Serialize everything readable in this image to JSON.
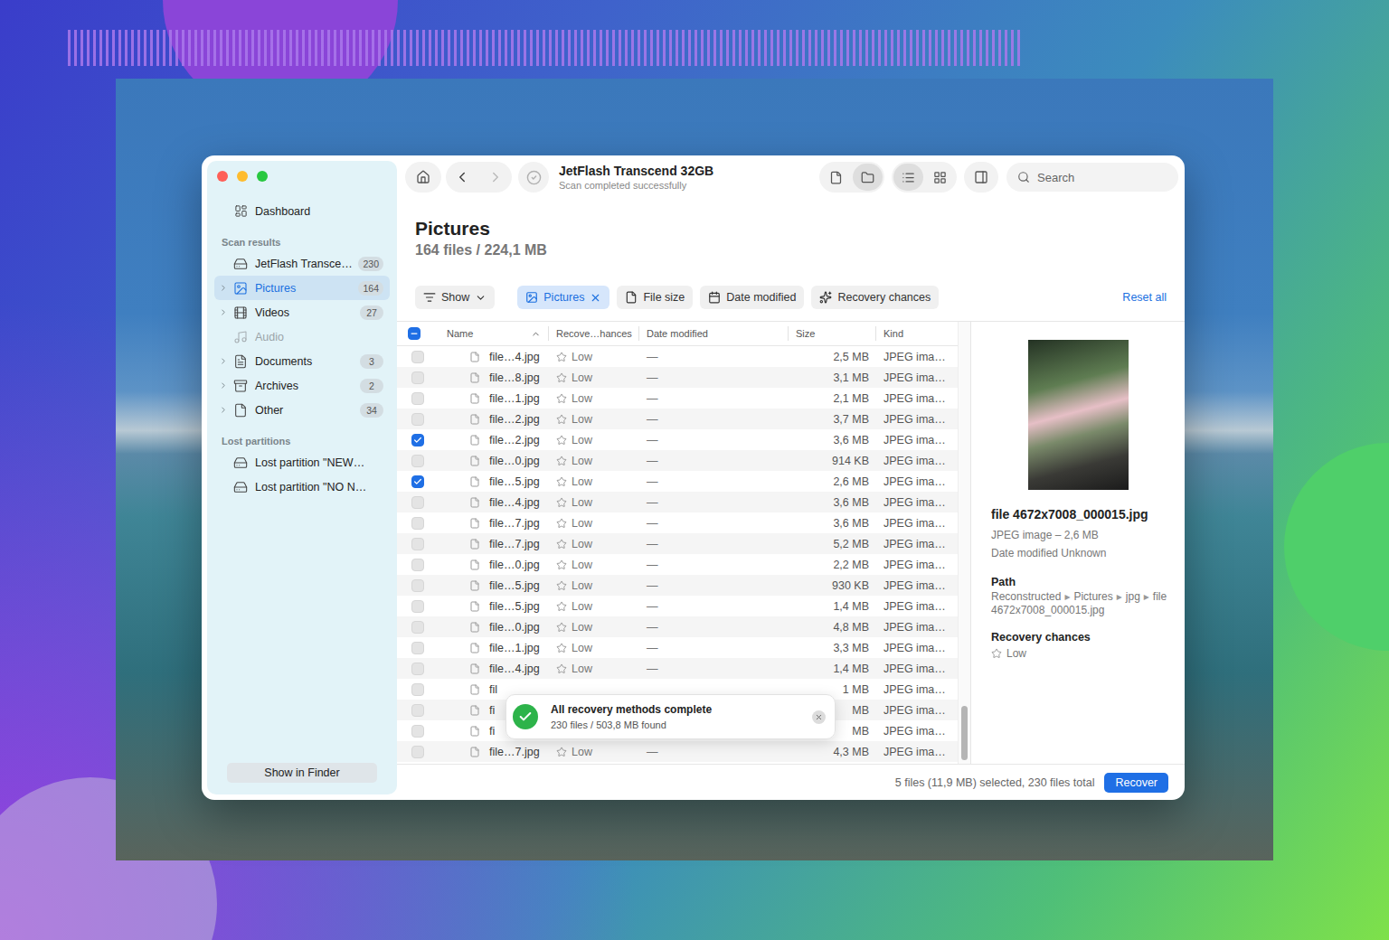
{
  "window": {
    "title": "JetFlash Transcend 32GB",
    "subtitle": "Scan completed successfully"
  },
  "toolbar": {
    "view_modes": [
      {
        "kind": "file",
        "selected": false
      },
      {
        "kind": "folder",
        "selected": true
      }
    ],
    "layouts": [
      {
        "kind": "list",
        "selected": true
      },
      {
        "kind": "grid",
        "selected": false
      }
    ],
    "search": {
      "placeholder": "Search"
    }
  },
  "sidebar": {
    "dashboard": "Dashboard",
    "sections": [
      {
        "header": "Scan results",
        "items": [
          {
            "label": "JetFlash Transce…",
            "count": "230",
            "kind": "drive",
            "expandable": false,
            "selected": false,
            "disabled": false
          },
          {
            "label": "Pictures",
            "count": "164",
            "kind": "pictures",
            "expandable": true,
            "selected": true,
            "disabled": false
          },
          {
            "label": "Videos",
            "count": "27",
            "kind": "videos",
            "expandable": true,
            "selected": false,
            "disabled": false
          },
          {
            "label": "Audio",
            "count": "",
            "kind": "audio",
            "expandable": false,
            "selected": false,
            "disabled": true
          },
          {
            "label": "Documents",
            "count": "3",
            "kind": "documents",
            "expandable": true,
            "selected": false,
            "disabled": false
          },
          {
            "label": "Archives",
            "count": "2",
            "kind": "archives",
            "expandable": true,
            "selected": false,
            "disabled": false
          },
          {
            "label": "Other",
            "count": "34",
            "kind": "other",
            "expandable": true,
            "selected": false,
            "disabled": false
          }
        ]
      },
      {
        "header": "Lost partitions",
        "items": [
          {
            "label": "Lost partition \"NEW…",
            "count": "",
            "kind": "partition",
            "expandable": false,
            "selected": false,
            "disabled": false
          },
          {
            "label": "Lost partition \"NO N…",
            "count": "",
            "kind": "partition",
            "expandable": false,
            "selected": false,
            "disabled": false
          }
        ]
      }
    ],
    "button": "Show in Finder"
  },
  "content": {
    "title": "Pictures",
    "summary": "164 files / 224,1 MB"
  },
  "filters": [
    {
      "label": "Show",
      "kind": "dropdown",
      "selected": false
    },
    {
      "label": "Pictures",
      "kind": "chip",
      "selected": true
    },
    {
      "label": "File size",
      "kind": "size",
      "selected": false
    },
    {
      "label": "Date modified",
      "kind": "date",
      "selected": false
    },
    {
      "label": "Recovery chances",
      "kind": "chances",
      "selected": false
    }
  ],
  "reset": "Reset all",
  "table": {
    "select_all": {
      "checked": false,
      "indeterminate": true
    },
    "columns": [
      {
        "label": "Name",
        "sorted": true
      },
      {
        "label": "Recove…hances",
        "sorted": false
      },
      {
        "label": "Date modified",
        "sorted": false
      },
      {
        "label": "Size",
        "sorted": false
      },
      {
        "label": "Kind",
        "sorted": false
      }
    ],
    "rows": [
      {
        "name": "file…4.jpg",
        "chances": "Low",
        "stars": 0,
        "date": "—",
        "size": "2,5 MB",
        "kind": "JPEG ima…",
        "checked": false
      },
      {
        "name": "file…8.jpg",
        "chances": "Low",
        "stars": 0,
        "date": "—",
        "size": "3,1 MB",
        "kind": "JPEG ima…",
        "checked": false
      },
      {
        "name": "file…1.jpg",
        "chances": "Low",
        "stars": 0,
        "date": "—",
        "size": "2,1 MB",
        "kind": "JPEG ima…",
        "checked": false
      },
      {
        "name": "file…2.jpg",
        "chances": "Low",
        "stars": 0,
        "date": "—",
        "size": "3,7 MB",
        "kind": "JPEG ima…",
        "checked": false
      },
      {
        "name": "file…2.jpg",
        "chances": "Low",
        "stars": 0,
        "date": "—",
        "size": "3,6 MB",
        "kind": "JPEG ima…",
        "checked": true
      },
      {
        "name": "file…0.jpg",
        "chances": "Low",
        "stars": 0,
        "date": "—",
        "size": "914 KB",
        "kind": "JPEG ima…",
        "checked": false
      },
      {
        "name": "file…5.jpg",
        "chances": "Low",
        "stars": 0,
        "date": "—",
        "size": "2,6 MB",
        "kind": "JPEG ima…",
        "checked": true
      },
      {
        "name": "file…4.jpg",
        "chances": "Low",
        "stars": 0,
        "date": "—",
        "size": "3,6 MB",
        "kind": "JPEG ima…",
        "checked": false
      },
      {
        "name": "file…7.jpg",
        "chances": "Low",
        "stars": 0,
        "date": "—",
        "size": "3,6 MB",
        "kind": "JPEG ima…",
        "checked": false
      },
      {
        "name": "file…7.jpg",
        "chances": "Low",
        "stars": 0,
        "date": "—",
        "size": "5,2 MB",
        "kind": "JPEG ima…",
        "checked": false
      },
      {
        "name": "file…0.jpg",
        "chances": "Low",
        "stars": 0,
        "date": "—",
        "size": "2,2 MB",
        "kind": "JPEG ima…",
        "checked": false
      },
      {
        "name": "file…5.jpg",
        "chances": "Low",
        "stars": 0,
        "date": "—",
        "size": "930 KB",
        "kind": "JPEG ima…",
        "checked": false
      },
      {
        "name": "file…5.jpg",
        "chances": "Low",
        "stars": 0,
        "date": "—",
        "size": "1,4 MB",
        "kind": "JPEG ima…",
        "checked": false
      },
      {
        "name": "file…0.jpg",
        "chances": "Low",
        "stars": 0,
        "date": "—",
        "size": "4,8 MB",
        "kind": "JPEG ima…",
        "checked": false
      },
      {
        "name": "file…1.jpg",
        "chances": "Low",
        "stars": 0,
        "date": "—",
        "size": "3,3 MB",
        "kind": "JPEG ima…",
        "checked": false
      },
      {
        "name": "file…4.jpg",
        "chances": "Low",
        "stars": 0,
        "date": "—",
        "size": "1,4 MB",
        "kind": "JPEG ima…",
        "checked": false
      },
      {
        "name": "fil",
        "chances": "",
        "date": "",
        "size": "1 MB",
        "kind": "JPEG ima…",
        "checked": false
      },
      {
        "name": "fi",
        "chances": "",
        "date": "",
        "size": "MB",
        "kind": "JPEG ima…",
        "checked": false
      },
      {
        "name": "fi",
        "chances": "",
        "date": "",
        "size": "MB",
        "kind": "JPEG ima…",
        "checked": false
      },
      {
        "name": "file…7.jpg",
        "chances": "Low",
        "stars": 0,
        "date": "—",
        "size": "4,3 MB",
        "kind": "JPEG ima…",
        "checked": false
      }
    ]
  },
  "preview": {
    "file_name": "file 4672x7008_000015.jpg",
    "info": "JPEG image – 2,6 MB",
    "date": "Date modified Unknown",
    "path_label": "Path",
    "path": [
      "Reconstructed",
      "Pictures",
      "jpg",
      "file 4672x7008_000015.jpg"
    ],
    "path_separator": "▸",
    "chances_label": "Recovery chances",
    "chances": "Low",
    "stars": 0
  },
  "toast": {
    "title": "All recovery methods complete",
    "detail": "230 files / 503,8 MB found"
  },
  "status": {
    "selection": "5 files (11,9 MB) selected, 230 files total",
    "button": "Recover"
  }
}
